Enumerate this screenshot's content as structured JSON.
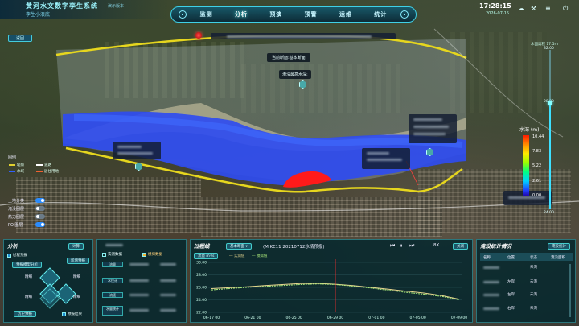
{
  "header": {
    "title": "黄河水文数字孪生系统",
    "title_suffix": "演示版本",
    "subtitle": "孪生小浪底",
    "nav": [
      "监测",
      "分析",
      "预演",
      "预警",
      "运维",
      "统计"
    ],
    "nav_active": "分析",
    "time": "17:28:15",
    "date": "2026-07-15"
  },
  "map": {
    "back_label": "返回",
    "section_label": "当前断面:基本断面",
    "depth_label": "淹没最高水深:",
    "right_top_label": "水面高程 17.5m",
    "legend": {
      "title": "图例",
      "items": [
        {
          "label": "堤防",
          "color": "#e0d030"
        },
        {
          "label": "道路",
          "color": "#ffffff"
        },
        {
          "label": "水域",
          "color": "#3060ff"
        },
        {
          "label": "居住用地",
          "color": "#f06030"
        }
      ]
    },
    "layers": [
      {
        "label": "土地分类",
        "on": true
      },
      {
        "label": "淹没图层",
        "on": false
      },
      {
        "label": "热力图层",
        "on": false
      },
      {
        "label": "POI图层",
        "on": true
      }
    ],
    "depth_scale": {
      "title": "水深 (m)",
      "labels": [
        "10.44",
        "7.83",
        "5.22",
        "2.61",
        "0.00"
      ]
    },
    "elevation_slider": {
      "ticks": [
        "32.00",
        "28.00",
        "24.00"
      ],
      "value": 0.33
    }
  },
  "analysis_panel": {
    "title": "分析",
    "top_btn": "计算",
    "check1": "过程预报",
    "btn1": "新增预报",
    "btn2": "预报模型分析",
    "node_labels": [
      "精细",
      "精细",
      "精细",
      "精细"
    ],
    "bottom_btn": "历史预报",
    "check2": "预报结果"
  },
  "list_panel": {
    "tab1": "实测数据",
    "tab2": "模拟数据",
    "rows": [
      "流量",
      "水位计",
      "流速",
      "水量统计"
    ]
  },
  "process_panel": {
    "title": "过程线",
    "dropdown": "基本断面",
    "scenario": "(MIKE11 20210712水情预报)",
    "series_label": "流量 m³/s",
    "legend_measured": "实测值",
    "legend_simulated": "模拟值",
    "speed": "8X",
    "close": "关闭"
  },
  "stats_panel": {
    "title": "淹没统计情况",
    "btn": "淹没统计",
    "headers": [
      "名称",
      "位置",
      "状态",
      "淹没面积"
    ],
    "rows": [
      {
        "loc": "",
        "status": "未淹"
      },
      {
        "loc": "左岸",
        "status": "未淹"
      },
      {
        "loc": "左岸",
        "status": "未淹"
      },
      {
        "loc": "右岸",
        "status": "未淹"
      }
    ]
  },
  "chart_data": {
    "type": "line",
    "title": "",
    "ylabel": "",
    "ylim": [
      22.0,
      30.0
    ],
    "yticks": [
      "30.00",
      "28.00",
      "26.00",
      "24.00",
      "22.00"
    ],
    "x": [
      "06-17 00",
      "06-21 00",
      "06-25 00",
      "06-29 00",
      "07-01 00",
      "07-05 00",
      "07-09 00"
    ],
    "series": [
      {
        "name": "实测值",
        "color": "#e8d890",
        "values": [
          25.8,
          25.95,
          26.1,
          26.3,
          26.45,
          26.6,
          26.65,
          26.5,
          26.3,
          26.0,
          25.7,
          25.4,
          25.1,
          24.7,
          24.1
        ]
      },
      {
        "name": "模拟值",
        "color": "#a9e77a",
        "values": [
          25.6,
          25.8,
          26.0,
          26.15,
          26.3,
          26.45,
          26.55,
          26.45,
          26.2,
          25.9,
          25.55,
          25.2,
          24.9,
          24.55,
          24.0
        ]
      }
    ],
    "current_index": 7
  }
}
